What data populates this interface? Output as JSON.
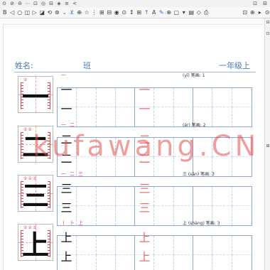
{
  "toolbar_top": {
    "icons": [
      {
        "name": "target-icon",
        "glyph": "⊙"
      },
      {
        "name": "lock-icon",
        "glyph": "⊘"
      },
      {
        "name": "zoom-out-icon",
        "glyph": "⊖"
      },
      {
        "name": "more-icon",
        "glyph": "⋯"
      },
      {
        "name": "page-icon",
        "glyph": "⊡"
      },
      {
        "name": "record-icon",
        "glyph": "◎"
      },
      {
        "name": "collapse-icon",
        "glyph": "⊟"
      },
      {
        "name": "diamond-icon",
        "glyph": "◈"
      },
      {
        "name": "list-icon",
        "glyph": "≡"
      },
      {
        "name": "back-icon",
        "glyph": "<"
      }
    ],
    "right_icons": [
      {
        "name": "window-icon",
        "glyph": "⊡"
      },
      {
        "name": "panel-icon",
        "glyph": "⊟"
      }
    ]
  },
  "toolbar": {
    "icons": [
      {
        "name": "bold-icon",
        "glyph": "B"
      },
      {
        "name": "prev-icon",
        "glyph": "◁"
      },
      {
        "name": "ellipse-icon",
        "glyph": "○"
      },
      {
        "name": "split-view-icon",
        "glyph": "◫"
      },
      {
        "name": "next-icon",
        "glyph": "▷"
      },
      {
        "name": "fit-page-icon",
        "glyph": "◪"
      },
      {
        "name": "rotate-icon",
        "glyph": "⟲"
      },
      {
        "name": "settings-icon",
        "glyph": "⊛"
      },
      {
        "name": "chevron-down-icon",
        "glyph": "⌄"
      },
      {
        "name": "download-icon",
        "glyph": "⊻"
      },
      {
        "name": "zoom-in-icon",
        "glyph": "⊕"
      },
      {
        "name": "star-icon",
        "glyph": "☆"
      },
      {
        "name": "more-vert-icon",
        "glyph": "⋮"
      },
      {
        "name": "grid-view-icon",
        "glyph": "⊞"
      },
      {
        "name": "collapse-icon",
        "glyph": "⊟"
      },
      {
        "name": "record-icon",
        "glyph": "◉"
      },
      {
        "name": "target-icon",
        "glyph": "⊙"
      },
      {
        "name": "scroll-icon",
        "glyph": "↕"
      },
      {
        "name": "thumbnails-icon",
        "glyph": "⊞"
      },
      {
        "name": "upload-icon",
        "glyph": "↑"
      },
      {
        "name": "text-tool-icon",
        "glyph": "A"
      },
      {
        "name": "pen-icon",
        "glyph": "✎"
      },
      {
        "name": "add-annotation-icon",
        "glyph": "⊕"
      },
      {
        "name": "rectangle-icon",
        "glyph": "▢"
      },
      {
        "name": "dropdown-icon",
        "glyph": "▾"
      },
      {
        "name": "list-icon",
        "glyph": "▤"
      },
      {
        "name": "shape-icon",
        "glyph": "◇"
      },
      {
        "name": "print-icon",
        "glyph": "⎙"
      }
    ],
    "right_icons": [
      {
        "name": "page-icon",
        "glyph": "⊡"
      },
      {
        "name": "zoom-icon",
        "glyph": "⊕"
      },
      {
        "name": "play-icon",
        "glyph": "▸"
      },
      {
        "name": "view-icon",
        "glyph": "⊙"
      }
    ]
  },
  "side_icons": [
    {
      "name": "collapse-panel-icon",
      "glyph": "⊟"
    },
    {
      "name": "page-panel-icon",
      "glyph": "⊡"
    },
    {
      "name": "grid-panel-icon",
      "glyph": "⊞"
    }
  ],
  "header": {
    "name_label": "姓名:",
    "class_label": "班",
    "grade_label": "一年级上"
  },
  "watermark": "kufawang.CN",
  "rows": [
    {
      "char": "一",
      "label": "(yī) 笔画: 1",
      "strokes": [
        "一"
      ],
      "marks": [
        "①"
      ]
    },
    {
      "char": "二",
      "label": "(èr) 笔画: 2",
      "strokes": [
        "一",
        "二"
      ],
      "marks": [
        "①",
        "②"
      ]
    },
    {
      "char": "三",
      "label": "三 (sān) 笔画: 3",
      "strokes": [
        "一",
        "二",
        "三"
      ],
      "marks": [
        "①",
        "②",
        "③"
      ]
    },
    {
      "char": "上",
      "label": "上 (shàng) 笔画: 3",
      "strokes": [
        "丨",
        "卜",
        "上"
      ],
      "marks": [
        "①",
        "②",
        "③"
      ]
    }
  ],
  "colors": {
    "accent": "#4a78b5",
    "stroke_red": "#e0474c",
    "grid_line": "#8da6d3",
    "watermark": "#e24e4e"
  }
}
